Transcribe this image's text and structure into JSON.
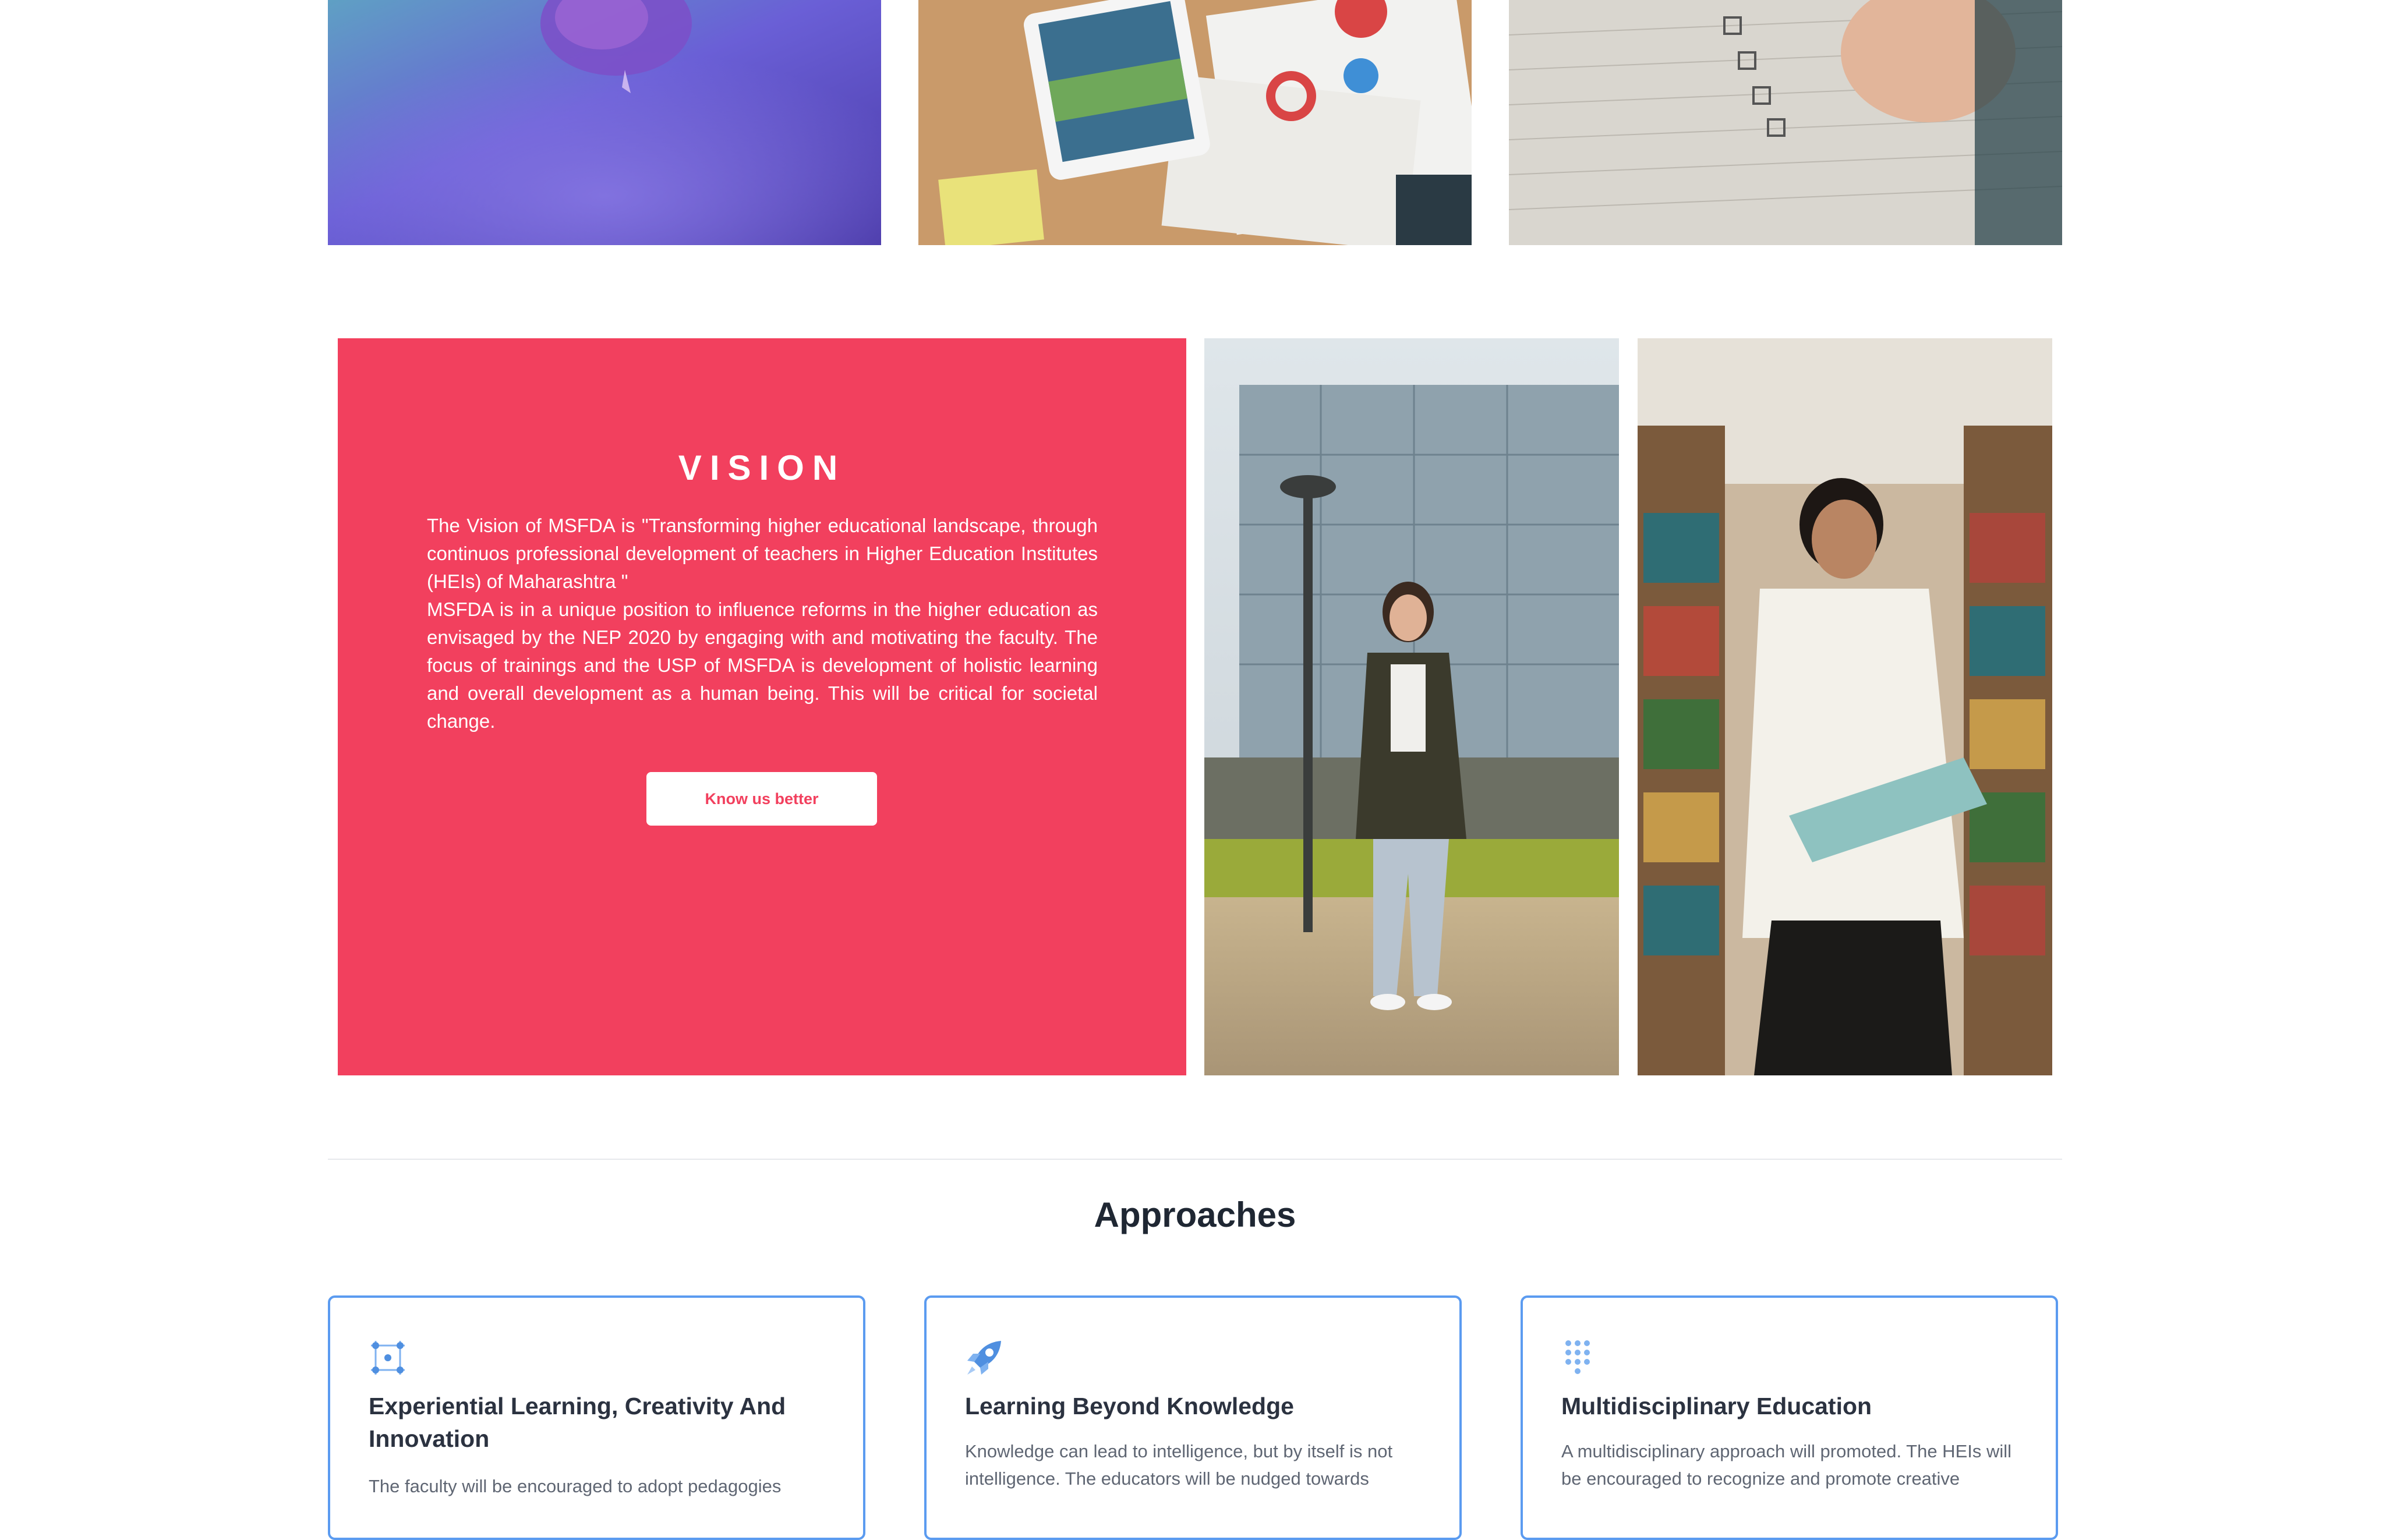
{
  "vision": {
    "title": "VISION",
    "paragraph_1": "The Vision of MSFDA is \"Transforming higher educational landscape, through continuos professional development of teachers in Higher Education Institutes (HEIs) of Maharashtra \"",
    "paragraph_2": "MSFDA is in a unique position to influence reforms in the higher education as envisaged by the NEP 2020 by engaging with and motivating the faculty. The focus of trainings and the USP of MSFDA is development of holistic learning and overall development as a human being. This will be critical for societal change.",
    "button_label": "Know us better"
  },
  "approaches": {
    "title": "Approaches",
    "cards": [
      {
        "icon": "network-grid-icon",
        "title": "Experiential Learning, Creativity And Innovation",
        "text": "The faculty will be encouraged to adopt pedagogies"
      },
      {
        "icon": "rocket-icon",
        "title": "Learning Beyond Knowledge",
        "text": "Knowledge can lead to intelligence, but by itself is not intelligence. The educators will be nudged towards"
      },
      {
        "icon": "dot-grid-icon",
        "title": "Multidisciplinary Education",
        "text": "A multidisciplinary approach will promoted. The HEIs will be encouraged to recognize and promote creative"
      }
    ]
  },
  "colors": {
    "vision_background": "#f2405e",
    "card_border": "#5b9bf0",
    "heading": "#1f2733"
  }
}
